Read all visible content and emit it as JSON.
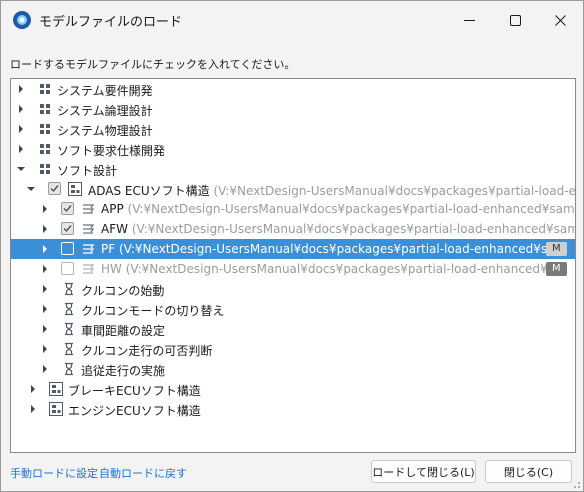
{
  "window": {
    "title": "モデルファイルのロード"
  },
  "instruction": "ロードするモデルファイルにチェックを入れてください。",
  "tree": [
    {
      "label": "システム要件開発",
      "path": ""
    },
    {
      "label": "システム論理設計",
      "path": ""
    },
    {
      "label": "システム物理設計",
      "path": ""
    },
    {
      "label": "ソフト要求仕様開発",
      "path": ""
    },
    {
      "label": "ソフト設計",
      "path": ""
    },
    {
      "label": "ADAS ECUソフト構造",
      "path": "(V:¥NextDesign-UsersManual¥docs¥packages¥partial-load-enha"
    },
    {
      "label": "APP",
      "path": "(V:¥NextDesign-UsersManual¥docs¥packages¥partial-load-enhanced¥sample"
    },
    {
      "label": "AFW",
      "path": "(V:¥NextDesign-UsersManual¥docs¥packages¥partial-load-enhanced¥samp"
    },
    {
      "label": "PF",
      "path": "(V:¥NextDesign-UsersManual¥docs¥packages¥partial-load-enhanced¥sa",
      "badge": "M"
    },
    {
      "label": "HW",
      "path": "(V:¥NextDesign-UsersManual¥docs¥packages¥partial-load-enhanced¥sa",
      "badge": "M"
    },
    {
      "label": "クルコンの始動",
      "path": ""
    },
    {
      "label": "クルコンモードの切り替え",
      "path": ""
    },
    {
      "label": "車間距離の設定",
      "path": ""
    },
    {
      "label": "クルコン走行の可否判断",
      "path": ""
    },
    {
      "label": "追従走行の実施",
      "path": ""
    },
    {
      "label": "ブレーキECUソフト構造",
      "path": ""
    },
    {
      "label": "エンジンECUソフト構造",
      "path": ""
    }
  ],
  "footer": {
    "link_manual": "手動ロードに設定",
    "link_auto": "自動ロードに戻す",
    "btn_load_close": "ロードして閉じる(L)",
    "btn_close": "閉じる(C)"
  },
  "icons": {
    "app": "next-design-logo-icon",
    "category": "category-grid-icon",
    "structure": "structure-diagram-icon",
    "model": "model-stack-icon",
    "sequence": "sequence-icon"
  },
  "colors": {
    "selection": "#3b8fd6",
    "link": "#1f6fd1",
    "path_text": "#9b9b9b",
    "badge": "#7a7a7a"
  }
}
